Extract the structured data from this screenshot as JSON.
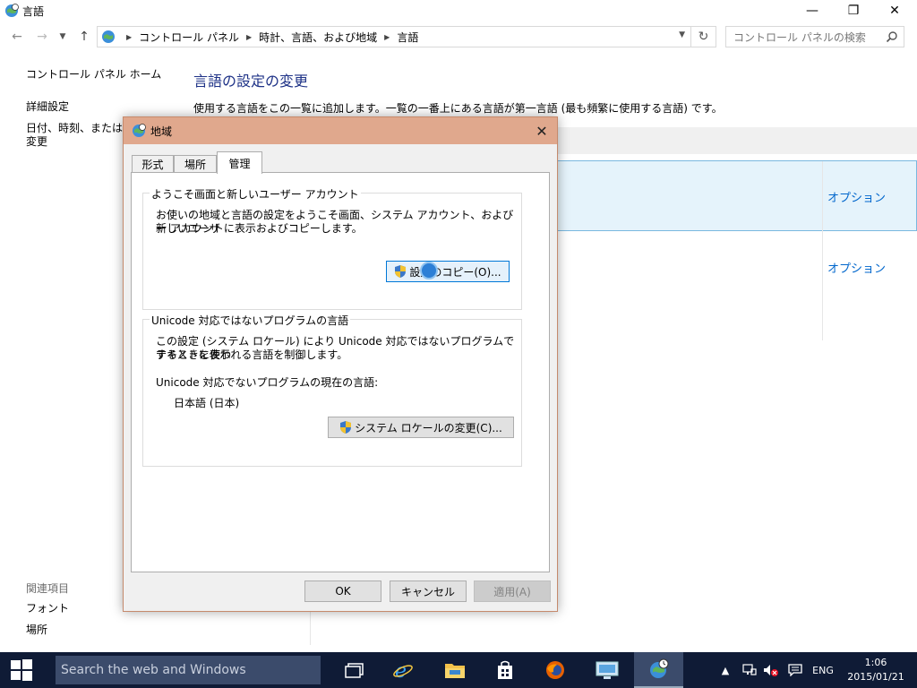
{
  "window": {
    "title": "言語",
    "min_glyph": "—",
    "max_glyph": "❐",
    "close_glyph": "✕"
  },
  "address": {
    "crumbs": [
      "コントロール パネル",
      "時計、言語、および地域",
      "言語"
    ],
    "search_placeholder": "コントロール パネルの検索"
  },
  "left_pane": {
    "home": "コントロール パネル ホーム",
    "advanced": "詳細設定",
    "datetime_line1": "日付、時刻、または数値",
    "datetime_line2": "変更",
    "related_heading": "関連項目",
    "fonts": "フォント",
    "location": "場所"
  },
  "main": {
    "heading": "言語の設定の変更",
    "description": "使用する言語をこの一覧に追加します。一覧の一番上にある言語が第一言語 (最も頻繁に使用する言語) です。",
    "option1": "オプション",
    "option2": "オプション"
  },
  "dialog": {
    "title": "地域",
    "close_glyph": "✕",
    "tabs": [
      "形式",
      "場所",
      "管理"
    ],
    "welcome_group": {
      "label": "ようこそ画面と新しいユーザー アカウント",
      "text_line1": "お使いの地域と言語の設定をようこそ画面、システム アカウント、および新しいユーザ",
      "text_line2": "ー アカウントに表示およびコピーします。",
      "button": "設定のコピー(O)..."
    },
    "unicode_group": {
      "label": "Unicode 対応ではないプログラムの言語",
      "text_line1": "この設定 (システム ロケール) により Unicode 対応ではないプログラムでテキストを表示",
      "text_line2": "するときに使われる言語を制御します。",
      "current_label": "Unicode 対応でないプログラムの現在の言語:",
      "current_value": "日本語 (日本)",
      "button": "システム ロケールの変更(C)..."
    },
    "ok": "OK",
    "cancel": "キャンセル",
    "apply": "適用(A)"
  },
  "taskbar": {
    "search": "Search the web and Windows",
    "lang": "ENG",
    "time": "1:06",
    "date": "2015/01/21"
  },
  "colors": {
    "dialog_title": "#e0a88d",
    "link": "#0066cc",
    "heading": "#1e3287",
    "taskbar": "#0f1b36"
  }
}
